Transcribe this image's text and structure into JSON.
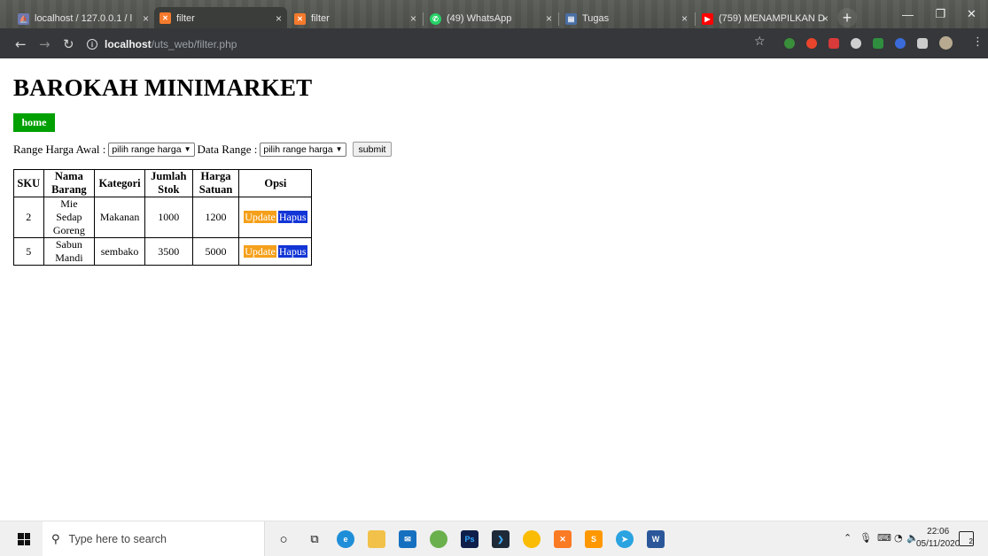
{
  "browser": {
    "tabs": [
      {
        "label": "localhost / 127.0.0.1 / l",
        "active": false
      },
      {
        "label": "filter",
        "active": true
      },
      {
        "label": "filter",
        "active": false
      },
      {
        "label": "(49) WhatsApp",
        "active": false
      },
      {
        "label": "Tugas",
        "active": false
      },
      {
        "label": "(759) MENAMPILKAN D",
        "active": false
      }
    ],
    "address_host": "localhost",
    "address_path": "/uts_web/filter.php"
  },
  "page": {
    "title": "BAROKAH MINIMARKET",
    "home_label": "home",
    "filter": {
      "range_label": "Range Harga Awal :",
      "range_select": "pilih range harga",
      "data_range_label": "Data Range :",
      "data_range_select": "pilih range harga",
      "submit_label": "submit"
    },
    "table": {
      "headers": [
        "SKU",
        "Nama Barang",
        "Kategori",
        "Jumlah Stok",
        "Harga Satuan",
        "Opsi"
      ],
      "rows": [
        {
          "sku": "2",
          "nama": "Mie Sedap Goreng",
          "kategori": "Makanan",
          "stok": "1000",
          "harga": "1200",
          "update": "Update",
          "hapus": "Hapus"
        },
        {
          "sku": "5",
          "nama": "Sabun Mandi",
          "kategori": "sembako",
          "stok": "3500",
          "harga": "5000",
          "update": "Update",
          "hapus": "Hapus"
        }
      ]
    }
  },
  "taskbar": {
    "search_placeholder": "Type here to search",
    "time": "22:06",
    "date": "05/11/2020",
    "notification_count": "2"
  },
  "colors": {
    "home_button": "#00a000",
    "update_button": "#f5a01a",
    "hapus_button": "#1235d6"
  }
}
